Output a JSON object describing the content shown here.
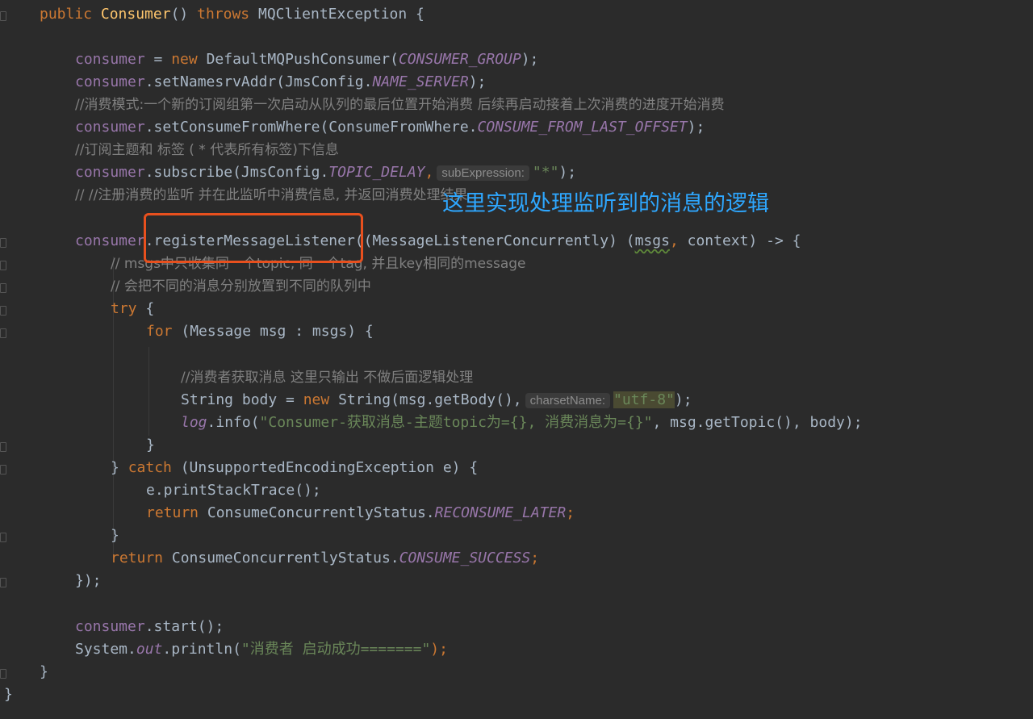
{
  "code": {
    "l1": {
      "kw": "public",
      "name": "Consumer",
      "parens": "()",
      "throws": "throws",
      "exc": "MQClientException {"
    },
    "l2": {
      "obj": "consumer",
      "eq": " = ",
      "new": "new",
      "cls": " DefaultMQPushConsumer(",
      "const": "CONSUMER_GROUP",
      "end": ");"
    },
    "l3": {
      "obj": "consumer",
      "call": ".setNamesrvAddr(JmsConfig.",
      "const": "NAME_SERVER",
      "end": ");"
    },
    "l4": {
      "comment": "//消费模式:一个新的订阅组第一次启动从队列的最后位置开始消费 后续再启动接着上次消费的进度开始消费"
    },
    "l5": {
      "obj": "consumer",
      "call": ".setConsumeFromWhere(ConsumeFromWhere.",
      "const": "CONSUME_FROM_LAST_OFFSET",
      "end": ");"
    },
    "l6": {
      "comment": "//订阅主题和 标签 ( * 代表所有标签)下信息"
    },
    "l7": {
      "obj": "consumer",
      "call": ".subscribe(JmsConfig.",
      "const": "TOPIC_DELAY",
      "comma": ",",
      "hint": "subExpression:",
      "str": "\"*\"",
      "end": ");"
    },
    "l8": {
      "comment": "// //注册消费的监听 并在此监听中消费信息, 并返回消费处理结果"
    },
    "l9": {
      "obj": "consumer",
      "call": ".registerMessageListener",
      "rest": "((MessageListenerConcurrently) (",
      "msgs": "msgs",
      "comma": ",",
      "ctx": " context) -> {"
    },
    "l10": {
      "comment": "// msgs中只收集同一个topic, 同一个tag, 并且key相同的message"
    },
    "l11": {
      "comment": "// 会把不同的消息分别放置到不同的队列中"
    },
    "l12": {
      "kw": "try",
      "rest": " {"
    },
    "l13": {
      "kw": "for",
      "rest": " (Message msg : msgs) {"
    },
    "l14": {
      "comment": "//消费者获取消息 这里只输出 不做后面逻辑处理"
    },
    "l15": {
      "a": "String body = ",
      "new": "new",
      "b": " String(msg.getBody(),",
      "hint": "charsetName:",
      "str": "\"utf-8\"",
      "end": ");"
    },
    "l16": {
      "log": "log",
      "a": ".info(",
      "str": "\"Consumer-获取消息-主题topic为={}, 消费消息为={}\"",
      "b": ", msg.getTopic(), body);"
    },
    "l17": {
      "text": "}"
    },
    "l18": {
      "a": "} ",
      "kw": "catch",
      "b": " (UnsupportedEncodingException e) {"
    },
    "l19": {
      "a": "e.printStackTrace();"
    },
    "l20": {
      "kw": "return",
      "a": " ConsumeConcurrentlyStatus.",
      "const": "RECONSUME_LATER",
      "end": ";"
    },
    "l21": {
      "text": "}"
    },
    "l22": {
      "kw": "return",
      "a": " ConsumeConcurrentlyStatus.",
      "const": "CONSUME_SUCCESS",
      "end": ";"
    },
    "l23": {
      "text": "});"
    },
    "l24": {
      "obj": "consumer",
      "a": ".start();"
    },
    "l25": {
      "a": "System.",
      "out": "out",
      "b": ".println(",
      "str": "\"消费者 启动成功=======\"",
      "end": ");"
    },
    "l26": {
      "text": "}"
    },
    "l27": {
      "text": "}"
    }
  },
  "annotation": {
    "text": "这里实现处理监听到的消息的逻辑"
  },
  "colors": {
    "background": "#2b2b2b",
    "keyword": "#cc7832",
    "annotation": "#2ea7ff",
    "highlight_box": "#e8501e"
  }
}
